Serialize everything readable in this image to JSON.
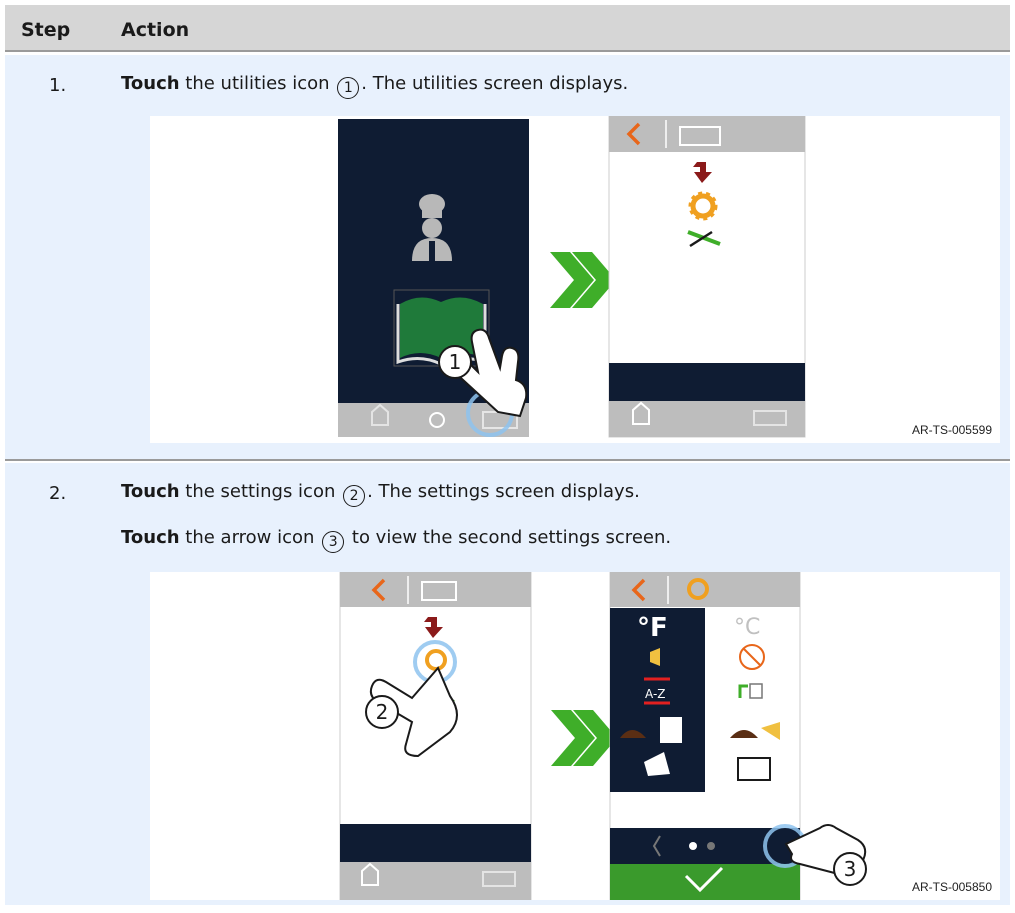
{
  "header": {
    "step_label": "Step",
    "action_label": "Action"
  },
  "steps": [
    {
      "number": "1.",
      "lines": [
        {
          "verb": "Touch",
          "pre": " the utilities icon ",
          "callout": "1",
          "post": ". The utilities screen displays."
        }
      ],
      "figure": {
        "code": "AR-TS-005599",
        "callouts": [
          "1"
        ]
      }
    },
    {
      "number": "2.",
      "lines": [
        {
          "verb": "Touch",
          "pre": " the settings icon ",
          "callout": "2",
          "post": ". The settings screen displays."
        },
        {
          "verb": "Touch",
          "pre": " the arrow icon ",
          "callout": "3",
          "post": " to view the second settings screen."
        }
      ],
      "figure": {
        "code": "AR-TS-005850",
        "callouts": [
          "2",
          "3"
        ],
        "settings_labels": {
          "fahrenheit": "°F",
          "celsius": "°C",
          "az": "A-Z"
        }
      }
    }
  ],
  "colors": {
    "navy": "#0f1c33",
    "gray_bar": "#bdbdbd",
    "orange": "#e8661a",
    "gear": "#f0a020",
    "green": "#3fae29",
    "book_green": "#1f7a3a",
    "dark_red": "#8b1a1a",
    "row_bg": "#e8f1fd"
  },
  "icons": [
    "chef-icon",
    "book-icon",
    "home-icon",
    "toolbox-icon",
    "back-arrow-icon",
    "gear-icon",
    "wrench-icon",
    "download-arrow-icon",
    "double-chevron-icon",
    "hand-pointer-icon",
    "speaker-icon",
    "checkmark-icon"
  ]
}
